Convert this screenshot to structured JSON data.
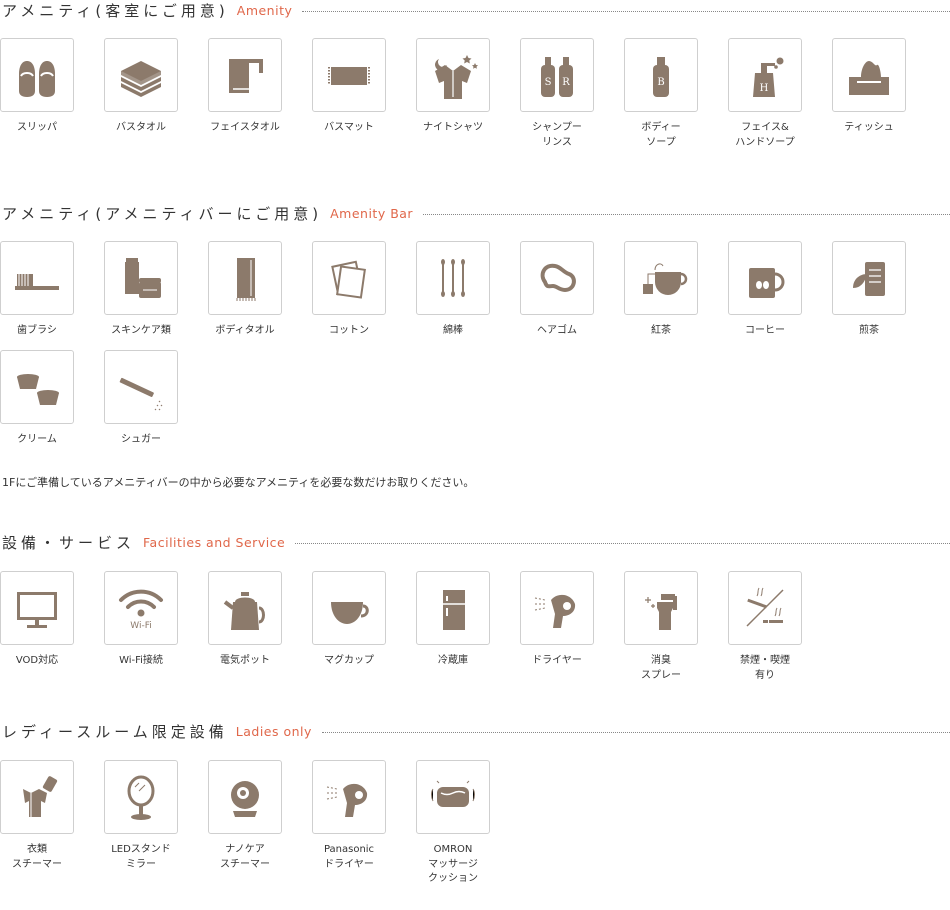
{
  "sections": [
    {
      "title_jp": "アメニティ(客室にご用意)",
      "title_en": "Amenity"
    },
    {
      "title_jp": "アメニティ(アメニティバーにご用意)",
      "title_en": "Amenity Bar"
    },
    {
      "title_jp": "設備・サービス",
      "title_en": "Facilities and Service"
    },
    {
      "title_jp": "レディースルーム限定設備",
      "title_en": "Ladies only"
    }
  ],
  "amenity_items": [
    {
      "label": "スリッパ",
      "icon": "slippers-icon"
    },
    {
      "label": "バスタオル",
      "icon": "bath-towel-icon"
    },
    {
      "label": "フェイスタオル",
      "icon": "face-towel-icon"
    },
    {
      "label": "バスマット",
      "icon": "bath-mat-icon"
    },
    {
      "label": "ナイトシャツ",
      "icon": "night-shirt-icon"
    },
    {
      "label": "シャンプー\nリンス",
      "icon": "shampoo-rinse-icon"
    },
    {
      "label": "ボディー\nソープ",
      "icon": "body-soap-icon"
    },
    {
      "label": "フェイス&\nハンドソープ",
      "icon": "hand-soap-icon"
    },
    {
      "label": "ティッシュ",
      "icon": "tissue-icon"
    }
  ],
  "amenity_bar_items": [
    {
      "label": "歯ブラシ",
      "icon": "toothbrush-icon"
    },
    {
      "label": "スキンケア類",
      "icon": "skincare-icon"
    },
    {
      "label": "ボディタオル",
      "icon": "body-towel-icon"
    },
    {
      "label": "コットン",
      "icon": "cotton-icon"
    },
    {
      "label": "綿棒",
      "icon": "cotton-swab-icon"
    },
    {
      "label": "ヘアゴム",
      "icon": "hair-tie-icon"
    },
    {
      "label": "紅茶",
      "icon": "tea-icon"
    },
    {
      "label": "コーヒー",
      "icon": "coffee-icon"
    },
    {
      "label": "煎茶",
      "icon": "green-tea-icon"
    },
    {
      "label": "クリーム",
      "icon": "creamer-icon"
    },
    {
      "label": "シュガー",
      "icon": "sugar-icon"
    }
  ],
  "note": "1Fにご準備しているアメニティバーの中から必要なアメニティを必要な数だけお取りください。",
  "facility_items": [
    {
      "label": "VOD対応",
      "icon": "tv-icon"
    },
    {
      "label": "Wi-Fi接続",
      "icon": "wifi-icon",
      "icon_text": "Wi-Fi"
    },
    {
      "label": "電気ポット",
      "icon": "electric-kettle-icon"
    },
    {
      "label": "マグカップ",
      "icon": "mug-icon"
    },
    {
      "label": "冷蔵庫",
      "icon": "refrigerator-icon"
    },
    {
      "label": "ドライヤー",
      "icon": "hair-dryer-icon"
    },
    {
      "label": "消臭\nスプレー",
      "icon": "deodorant-spray-icon"
    },
    {
      "label": "禁煙・喫煙\n有り",
      "icon": "smoking-icon"
    }
  ],
  "ladies_items": [
    {
      "label": "衣類\nスチーマー",
      "icon": "clothes-steamer-icon"
    },
    {
      "label": "LEDスタンド\nミラー",
      "icon": "led-mirror-icon"
    },
    {
      "label": "ナノケア\nスチーマー",
      "icon": "nanocare-steamer-icon"
    },
    {
      "label": "Panasonic\nドライヤー",
      "icon": "panasonic-dryer-icon"
    },
    {
      "label": "OMRON\nマッサージ\nクッション",
      "icon": "massage-cushion-icon"
    }
  ],
  "colors": {
    "icon": "#8c7a6b",
    "accent": "#e0674a",
    "border": "#cfcfcf"
  }
}
